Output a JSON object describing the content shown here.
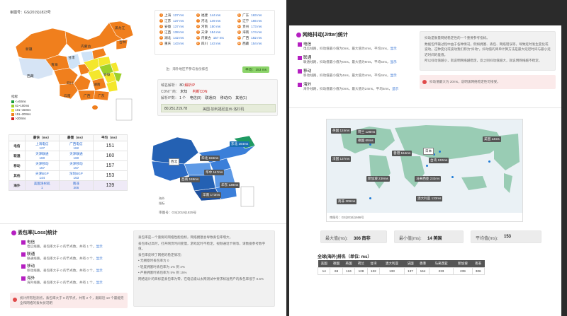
{
  "left": {
    "map_caption": "审图号：GS(2019)1823号",
    "map_labels": [
      "新疆",
      "西藏",
      "青海",
      "甘肃",
      "内蒙古",
      "黑龙江",
      "吉林",
      "辽宁",
      "四川",
      "云南",
      "广西",
      "广东",
      "湖南",
      "湖北",
      "河南",
      "山东",
      "江苏",
      "浙江",
      "福建",
      "江西",
      "贵州",
      "重庆",
      "陕西",
      "山西",
      "河北",
      "宁夏",
      "安徽"
    ],
    "legend_title": "指标",
    "legend": [
      {
        "label": "<=60ms",
        "color": "#1a9d3a"
      },
      {
        "label": "61~100ms",
        "color": "#9cd02a"
      },
      {
        "label": "101~150ms",
        "color": "#f4e72d"
      },
      {
        "label": "151~200ms",
        "color": "#f07f1d"
      },
      {
        "label": ">200ms",
        "color": "#d02222"
      }
    ],
    "ranking": [
      {
        "n": "1",
        "city": "上海",
        "ms": "127 ms"
      },
      {
        "n": "6",
        "city": "福建",
        "ms": "144 ms"
      },
      {
        "n": "11",
        "city": "广东",
        "ms": "163 ms"
      },
      {
        "n": "2",
        "city": "江苏",
        "ms": "137 ms"
      },
      {
        "n": "7",
        "city": "河北",
        "ms": "149 ms"
      },
      {
        "n": "12",
        "city": "辽宁",
        "ms": "166 ms"
      },
      {
        "n": "3",
        "city": "安徽",
        "ms": "137 ms"
      },
      {
        "n": "8",
        "city": "河南",
        "ms": "150 ms"
      },
      {
        "n": "13",
        "city": "贵州",
        "ms": "173 ms"
      },
      {
        "n": "4",
        "city": "江西",
        "ms": "138 ms"
      },
      {
        "n": "9",
        "city": "天津",
        "ms": "154 ms"
      },
      {
        "n": "14",
        "city": "海南",
        "ms": "174 ms"
      },
      {
        "n": "5",
        "city": "湖北",
        "ms": "142 ms"
      },
      {
        "n": "10",
        "city": "内蒙古",
        "ms": "157 ms"
      },
      {
        "n": "15",
        "city": "广西",
        "ms": "182 ms"
      },
      {
        "n": "16",
        "city": "重庆",
        "ms": "143 ms"
      },
      {
        "n": "17",
        "city": "四川",
        "ms": "143 ms"
      },
      {
        "n": "18",
        "city": "西藏",
        "ms": "154 ms"
      }
    ],
    "ranking_note": "注：海外地区不参与省份排名",
    "avg_label": "平均：153 ms",
    "dns": {
      "resolve_label": "域名解析：",
      "resolve_value": "80",
      "resolve_unit": "解析IP",
      "cdn_label": "CDN厂商：",
      "cdn_value": "未知",
      "cdn_extra": "判断CDN",
      "ip_label": "解析IP数：",
      "ip_value": "1 个",
      "ip_tabs": [
        "电信(0)",
        "联通(0)",
        "移动(0)",
        "其他(1)"
      ],
      "ip_row_ip": "80.251.219.78",
      "ip_row_addr": "美国-加利福尼亚州-洛杉矶"
    },
    "isp_table": {
      "headers": [
        "",
        "最快（ms）",
        "最慢（ms）",
        "平均（ms）"
      ],
      "rows": [
        {
          "isp": "电信",
          "fast_loc": "上海电信",
          "fast": "127",
          "slow_loc": "广西电信",
          "slow": "182",
          "avg": "151"
        },
        {
          "isp": "联通",
          "fast_loc": "天津联通",
          "fast": "160",
          "slow_loc": "天津联通",
          "slow": "160",
          "avg": "160"
        },
        {
          "isp": "移动",
          "fast_loc": "天津移动",
          "fast": "157",
          "slow_loc": "天津移动",
          "slow": "157",
          "avg": "157"
        },
        {
          "isp": "其他",
          "fast_loc": "天津BGP",
          "fast": "144",
          "slow_loc": "深圳BGP",
          "slow": "163",
          "avg": "153"
        },
        {
          "isp": "海外",
          "fast_loc": "美国洛杉矶",
          "fast": "1",
          "slow_loc": "南非",
          "slow": "306",
          "avg": "139"
        }
      ]
    },
    "region_map_caption": "审图号：GS(2019)1825号",
    "region_labels": [
      {
        "label": "东北 164ms"
      },
      {
        "label": "西北"
      },
      {
        "label": "华北 156ms"
      },
      {
        "label": "华中 147ms"
      },
      {
        "label": "西南 169ms"
      },
      {
        "label": "华东 138ms"
      },
      {
        "label": "华南 173ms"
      }
    ],
    "region_legend": [
      "海外",
      "指标"
    ],
    "loss": {
      "title": "丢包率(Loss)统计",
      "groups": [
        {
          "name": "电信",
          "text": "电信线路，丢包率大于 0 的节点数，共有 1 个，",
          "link": "显示"
        },
        {
          "name": "联通",
          "text": "联通线路，丢包率大于 0 的节点数，共有 0 个，",
          "link": "显示"
        },
        {
          "name": "移动",
          "text": "移动线路，丢包率大于 0 的节点数，共有 0 个，",
          "link": "显示"
        },
        {
          "name": "海外",
          "text": "海外线路，丢包率大于 0 的节点数，共有 1 个，",
          "link": "显示"
        }
      ],
      "note": "统计所有检测点，丢包率大于 0 的节点，共有 2 个，跟踪近 10 个最能完全和网络的丢失状况明",
      "desc": [
        "丢包率是一个重要的网络性能指标，网络拥塞会导致丢包率增大。",
        "丢包率过高时，打开网页时间变慢，游戏延时不稳定，视频通话卡顿等，请数据参考数字值。",
        "丢包率反映了网络的稳定情况：",
        "• 无拥塞时丢包率为 0",
        "• 轻度拥塞时丢包率为 1% 到 4%",
        "• 严重拥塞时丢包率为 5% 到 15%",
        "网络设计的目标是丢包率为零，在电信级以太网测试中要求标准用户的丢包率低于 0.5%"
      ]
    }
  },
  "right": {
    "jitter": {
      "title": "网络抖动(Jitter)统计",
      "groups": [
        {
          "name": "电信",
          "text": "电信线路，抖动值最小值为0ms，最大值为4ms，平均2ms，",
          "link": "显示"
        },
        {
          "name": "联通",
          "text": "联通线路，抖动值最小值为0ms，最大值为9ms，平均5ms，",
          "link": "显示"
        },
        {
          "name": "移动",
          "text": "移动线路，抖动值最小值为4ms，最大值为4ms，平均4ms，",
          "link": "显示"
        },
        {
          "name": "海外",
          "text": "海外线路，抖动值最小值为0ms，最大值为24ms，平均4ms，",
          "link": "显示"
        }
      ],
      "desc": [
        "抖动是衡量网络稳定性的一个重要参考指标。",
        "数据包传输过程中由于各种情况，例如拥塞、丢包、网络错误等，导致延时发生变化或波动。这种变化或波动我们称为\"抖动\"。抖动值的简单计算方法是最大延迟时间与最小延迟时间的差值。",
        "所以抖动值越小，就说明网络越稳定，反之则抖动值越大，就说明网络越不稳定。"
      ],
      "note": "抖动值最大为 20ms，说明该网络稳定性可接受。"
    },
    "world": {
      "caption": "审图号：GS(2016)1666号",
      "labels": [
        {
          "label": "英国 124ms"
        },
        {
          "label": "荷兰 128ms"
        },
        {
          "label": "德国 69ms"
        },
        {
          "label": "法国 137ms"
        },
        {
          "label": "香港 164ms"
        },
        {
          "label": "日本"
        },
        {
          "label": "台湾 132ms"
        },
        {
          "label": "美国 14ms"
        },
        {
          "label": "新加坡 239ms"
        },
        {
          "label": "马来西亚 233ms"
        },
        {
          "label": "澳大利亚 133ms"
        },
        {
          "label": "南非 306ms"
        }
      ]
    },
    "stats": [
      {
        "label": "最大值(ms):",
        "value": "306 南非"
      },
      {
        "label": "最小值(ms):",
        "value": "14 美国"
      },
      {
        "label": "平均值(ms):",
        "value": "153"
      }
    ],
    "global": {
      "title": "全球(海外)排名（单位: ms）",
      "headers": [
        "美国",
        "德国",
        "英国",
        "荷兰",
        "台湾",
        "澳大利亚",
        "法国",
        "香港",
        "马来西亚",
        "新加坡",
        "南非"
      ],
      "values": [
        "14",
        "69",
        "124",
        "128",
        "132",
        "133",
        "137",
        "164",
        "233",
        "239",
        "306"
      ]
    }
  }
}
